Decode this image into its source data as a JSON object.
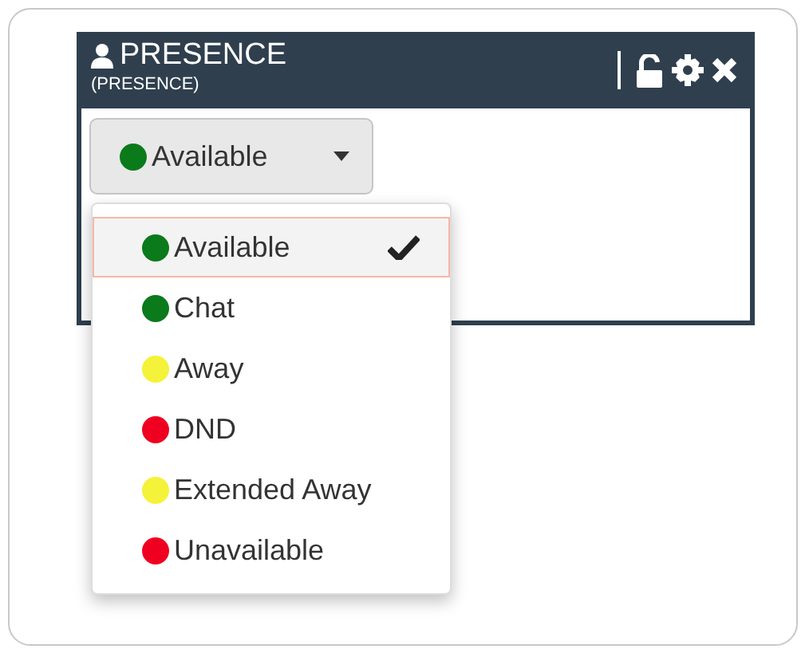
{
  "widget": {
    "title": "PRESENCE",
    "subtitle": "(PRESENCE)"
  },
  "status_button": {
    "label": "Available",
    "color": "#0a7a1a"
  },
  "menu": {
    "items": [
      {
        "label": "Available",
        "color": "#0a7a1a",
        "selected": true
      },
      {
        "label": "Chat",
        "color": "#0a7a1a",
        "selected": false
      },
      {
        "label": "Away",
        "color": "#f5f23a",
        "selected": false
      },
      {
        "label": "DND",
        "color": "#f00020",
        "selected": false
      },
      {
        "label": "Extended Away",
        "color": "#f5f23a",
        "selected": false
      },
      {
        "label": "Unavailable",
        "color": "#f00020",
        "selected": false
      }
    ]
  }
}
